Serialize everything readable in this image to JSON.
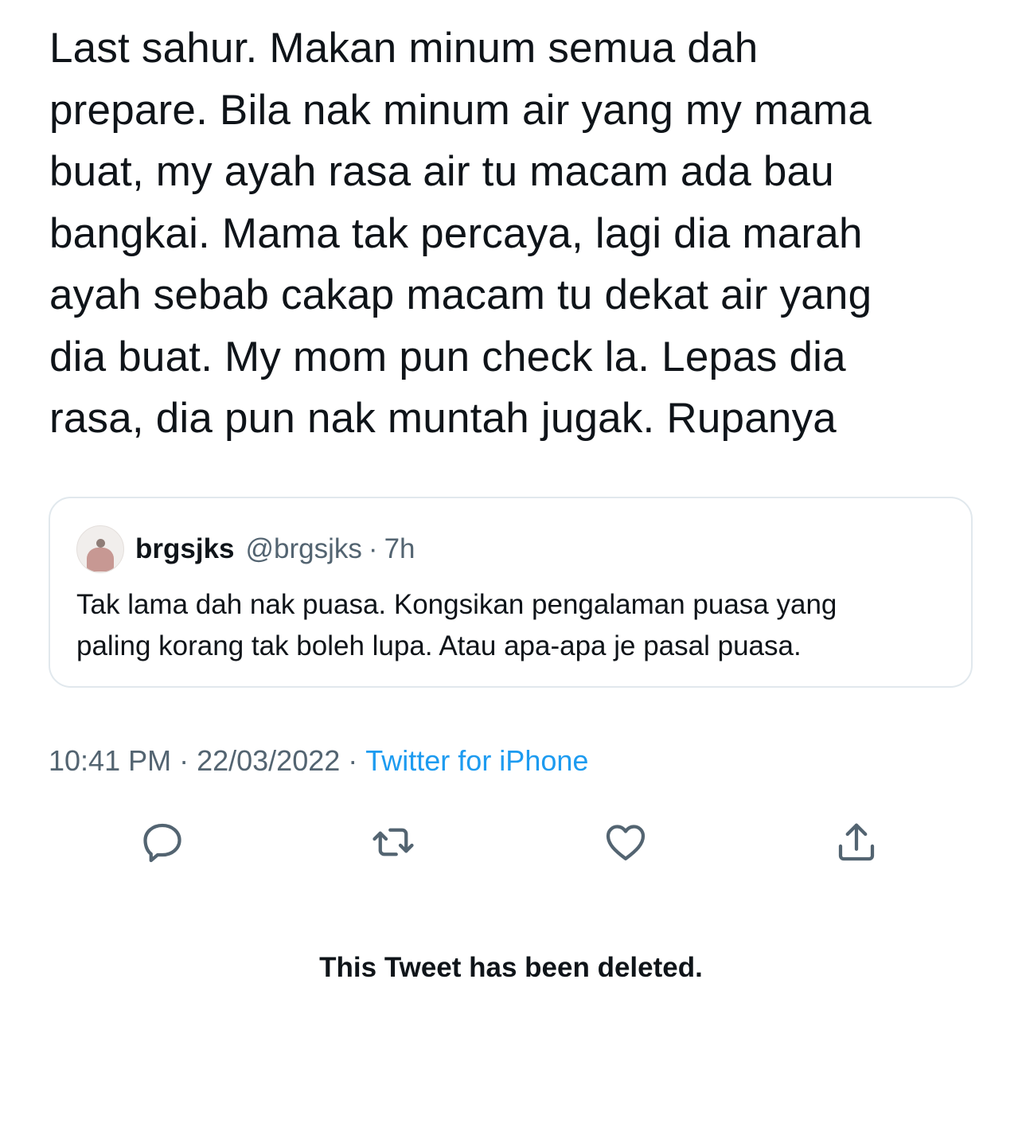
{
  "tweet": {
    "text": "Last sahur. Makan minum semua dah\nprepare. Bila nak minum air yang my mama\nbuat, my ayah rasa air tu macam ada bau\nbangkai. Mama tak percaya, lagi dia marah\nayah sebab cakap macam tu dekat air yang\ndia buat. My mom pun check la. Lepas dia\nrasa, dia pun nak muntah jugak. Rupanya"
  },
  "quote": {
    "name": "brgsjks",
    "handle": "@brgsjks",
    "separator": "·",
    "time": "7h",
    "text": "Tak lama dah nak puasa. Kongsikan pengalaman puasa yang\npaling korang tak boleh lupa. Atau apa-apa je pasal puasa."
  },
  "meta": {
    "time": "10:41 PM",
    "separator": "·",
    "date": "22/03/2022",
    "source": "Twitter for iPhone"
  },
  "actions": {
    "icons": [
      "reply-icon",
      "retweet-icon",
      "like-icon",
      "share-icon"
    ],
    "icon_color": "#536471"
  },
  "deleted_notice": "This Tweet has been deleted.",
  "colors": {
    "text": "#0f1419",
    "secondary": "#536471",
    "link": "#1d9bf0",
    "border": "#e1e8ed"
  }
}
